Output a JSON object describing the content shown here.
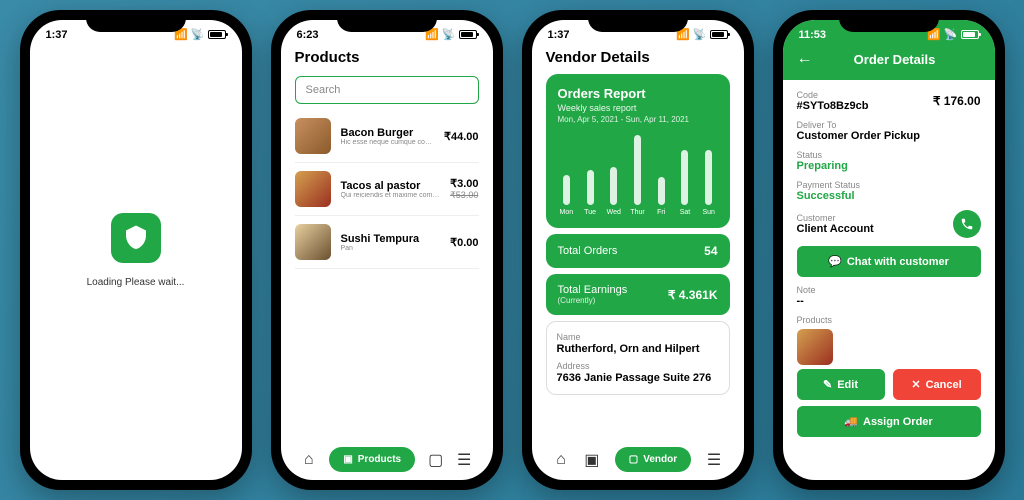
{
  "s1": {
    "time": "1:37",
    "loading": "Loading Please wait..."
  },
  "s2": {
    "time": "6:23",
    "title": "Products",
    "searchPlaceholder": "Search",
    "products": [
      {
        "name": "Bacon Burger",
        "desc": "Hic esse neque cumque commo...",
        "price": "₹44.00"
      },
      {
        "name": "Tacos al pastor",
        "desc": "Qui reiciendis et maxime commodi...",
        "price": "₹3.00",
        "old": "₹53.00"
      },
      {
        "name": "Sushi Tempura",
        "desc": "Pan",
        "price": "₹0.00"
      }
    ],
    "nav": "Products"
  },
  "s3": {
    "time": "1:37",
    "title": "Vendor Details",
    "report": {
      "title": "Orders Report",
      "sub": "Weekly sales report",
      "range": "Mon, Apr 5, 2021 - Sun, Apr 11, 2021"
    },
    "days": [
      "Mon",
      "Tue",
      "Wed",
      "Thur",
      "Fri",
      "Sat",
      "Sun"
    ],
    "bars": [
      30,
      35,
      38,
      70,
      28,
      55,
      55
    ],
    "totalOrdersLabel": "Total Orders",
    "totalOrders": "54",
    "earningsLabel": "Total Earnings",
    "earningsSub": "(Currently)",
    "earnings": "₹ 4.361K",
    "nameLabel": "Name",
    "name": "Rutherford, Orn and Hilpert",
    "addrLabel": "Address",
    "addr": "7636 Janie Passage Suite 276",
    "nav": "Vendor"
  },
  "s4": {
    "time": "11:53",
    "title": "Order Details",
    "codeLabel": "Code",
    "code": "#SYTo8Bz9cb",
    "price": "₹ 176.00",
    "deliverLabel": "Deliver To",
    "deliver": "Customer Order Pickup",
    "statusLabel": "Status",
    "status": "Preparing",
    "payLabel": "Payment Status",
    "pay": "Successful",
    "custLabel": "Customer",
    "cust": "Client Account",
    "chat": "Chat with customer",
    "noteLabel": "Note",
    "note": "--",
    "productsLabel": "Products",
    "edit": "Edit",
    "cancel": "Cancel",
    "assign": "Assign Order"
  },
  "chart_data": {
    "type": "bar",
    "title": "Orders Report",
    "subtitle": "Weekly sales report",
    "categories": [
      "Mon",
      "Tue",
      "Wed",
      "Thur",
      "Fri",
      "Sat",
      "Sun"
    ],
    "values": [
      30,
      35,
      38,
      70,
      28,
      55,
      55
    ],
    "date_range": "Mon, Apr 5, 2021 - Sun, Apr 11, 2021"
  }
}
